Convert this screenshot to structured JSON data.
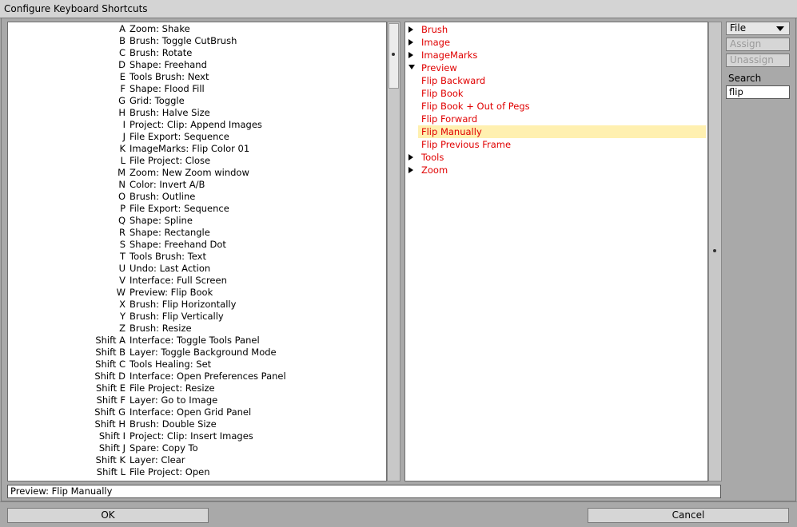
{
  "window": {
    "title": "Configure Keyboard Shortcuts"
  },
  "shortcuts": [
    {
      "key": "A",
      "action": "Zoom: Shake"
    },
    {
      "key": "B",
      "action": "Brush: Toggle CutBrush"
    },
    {
      "key": "C",
      "action": "Brush: Rotate"
    },
    {
      "key": "D",
      "action": "Shape: Freehand"
    },
    {
      "key": "E",
      "action": "Tools Brush: Next"
    },
    {
      "key": "F",
      "action": "Shape: Flood Fill"
    },
    {
      "key": "G",
      "action": "Grid: Toggle"
    },
    {
      "key": "H",
      "action": "Brush: Halve Size"
    },
    {
      "key": "I",
      "action": "Project: Clip: Append Images"
    },
    {
      "key": "J",
      "action": "File Export: Sequence"
    },
    {
      "key": "K",
      "action": "ImageMarks: Flip Color 01"
    },
    {
      "key": "L",
      "action": "File Project: Close"
    },
    {
      "key": "M",
      "action": "Zoom: New Zoom window"
    },
    {
      "key": "N",
      "action": "Color: Invert A/B"
    },
    {
      "key": "O",
      "action": "Brush: Outline"
    },
    {
      "key": "P",
      "action": "File Export: Sequence"
    },
    {
      "key": "Q",
      "action": "Shape: Spline"
    },
    {
      "key": "R",
      "action": "Shape: Rectangle"
    },
    {
      "key": "S",
      "action": "Shape: Freehand Dot"
    },
    {
      "key": "T",
      "action": "Tools Brush: Text"
    },
    {
      "key": "U",
      "action": "Undo: Last Action"
    },
    {
      "key": "V",
      "action": "Interface: Full Screen"
    },
    {
      "key": "W",
      "action": "Preview: Flip Book"
    },
    {
      "key": "X",
      "action": "Brush: Flip Horizontally"
    },
    {
      "key": "Y",
      "action": "Brush: Flip Vertically"
    },
    {
      "key": "Z",
      "action": "Brush: Resize"
    },
    {
      "key": "Shift A",
      "action": "Interface: Toggle Tools Panel"
    },
    {
      "key": "Shift B",
      "action": "Layer: Toggle Background Mode"
    },
    {
      "key": "Shift C",
      "action": "Tools Healing: Set"
    },
    {
      "key": "Shift D",
      "action": "Interface: Open Preferences Panel"
    },
    {
      "key": "Shift E",
      "action": "File Project: Resize"
    },
    {
      "key": "Shift F",
      "action": "Layer: Go to Image"
    },
    {
      "key": "Shift G",
      "action": "Interface: Open Grid Panel"
    },
    {
      "key": "Shift H",
      "action": "Brush: Double Size"
    },
    {
      "key": "Shift I",
      "action": "Project: Clip: Insert Images"
    },
    {
      "key": "Shift J",
      "action": "Spare: Copy To"
    },
    {
      "key": "Shift K",
      "action": "Layer: Clear"
    },
    {
      "key": "Shift L",
      "action": "File Project: Open"
    }
  ],
  "tree": [
    {
      "label": "Brush",
      "type": "folder",
      "expanded": false
    },
    {
      "label": "Image",
      "type": "folder",
      "expanded": false
    },
    {
      "label": "ImageMarks",
      "type": "folder",
      "expanded": false
    },
    {
      "label": "Preview",
      "type": "folder",
      "expanded": true
    },
    {
      "label": "Flip Backward",
      "type": "item"
    },
    {
      "label": "Flip Book",
      "type": "item"
    },
    {
      "label": "Flip Book + Out of Pegs",
      "type": "item"
    },
    {
      "label": "Flip Forward",
      "type": "item"
    },
    {
      "label": "Flip Manually",
      "type": "item",
      "selected": true
    },
    {
      "label": "Flip Previous Frame",
      "type": "item"
    },
    {
      "label": "Tools",
      "type": "folder",
      "expanded": false
    },
    {
      "label": "Zoom",
      "type": "folder",
      "expanded": false
    }
  ],
  "side": {
    "file_select": "File",
    "assign_label": "Assign",
    "unassign_label": "Unassign",
    "search_label": "Search",
    "search_value": "flip"
  },
  "status": {
    "text": "Preview: Flip Manually"
  },
  "buttons": {
    "ok": "OK",
    "cancel": "Cancel"
  },
  "colors": {
    "tree_text": "#e00000",
    "selection": "#fff0b0",
    "background": "#a9a9a9"
  }
}
